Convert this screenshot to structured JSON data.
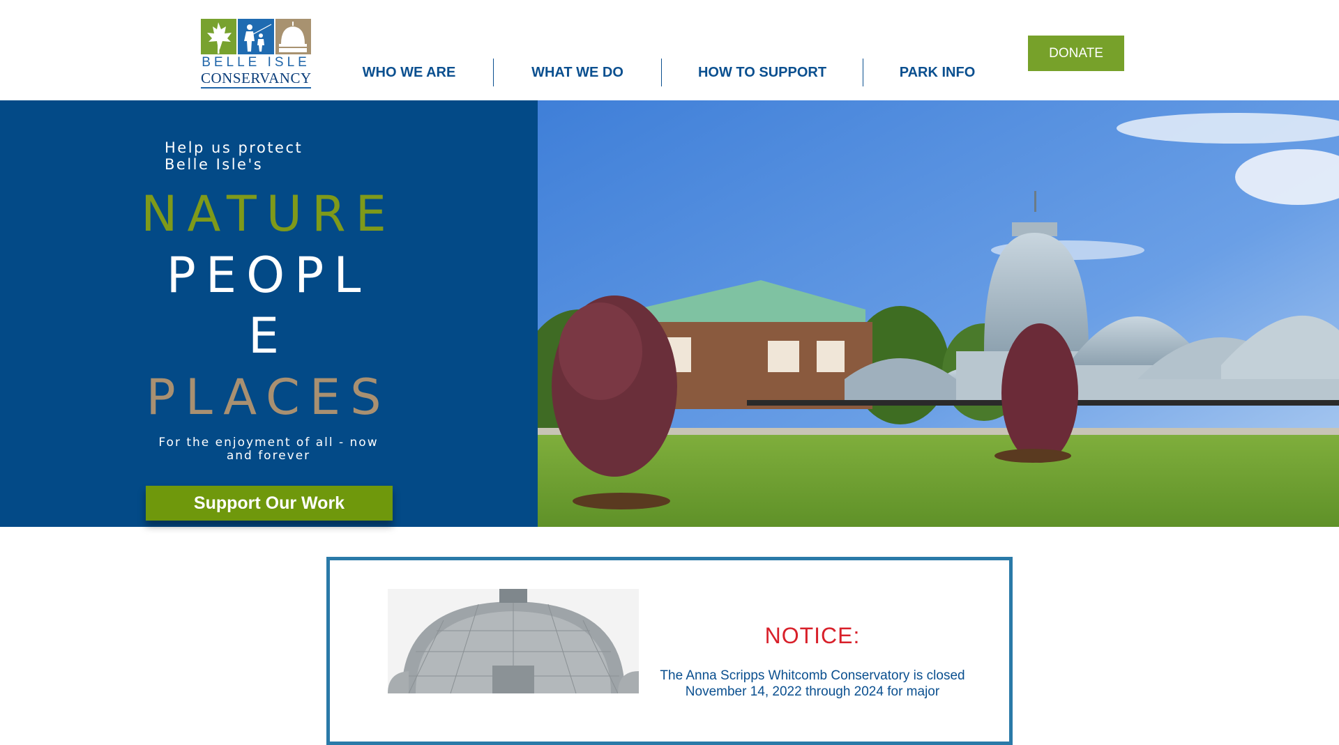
{
  "header": {
    "logo": {
      "line1": "BELLE ISLE",
      "line2": "CONSERVANCY"
    },
    "nav": [
      {
        "label": "WHO WE ARE"
      },
      {
        "label": "WHAT WE DO"
      },
      {
        "label": "HOW TO SUPPORT"
      },
      {
        "label": "PARK INFO"
      }
    ],
    "donate_label": "DONATE"
  },
  "hero": {
    "intro": "Help us protect Belle Isle's",
    "word1": "NATURE",
    "word2a": "PEOPL",
    "word2b": "E",
    "word3": "PLACES",
    "tagline": "For the enjoyment of all - now and forever",
    "button_label": "Support Our Work",
    "photo_icon": "conservatory-photo"
  },
  "notice": {
    "title": "NOTICE:",
    "text": "The Anna Scripps Whitcomb Conservatory is closed November 14, 2022 through 2024 for major",
    "photo_icon": "conservatory-dome-photo"
  },
  "colors": {
    "brand_blue": "#034a87",
    "nav_blue": "#0a4f8f",
    "green": "#77a12a",
    "olive": "#7f9a1a",
    "tan": "#a99071",
    "notice_red": "#d8202a",
    "notice_border": "#2a7aa8"
  }
}
